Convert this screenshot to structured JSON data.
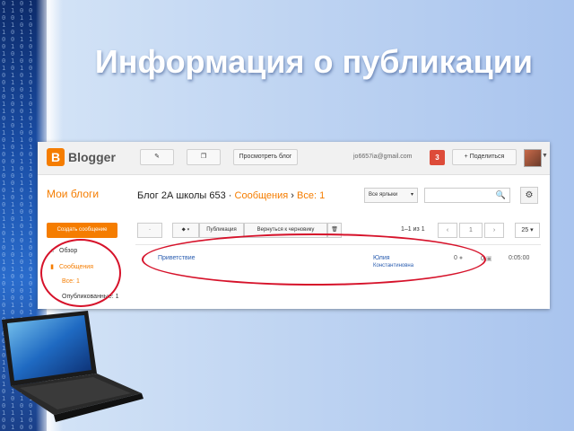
{
  "slide": {
    "title": "Информация о публикации"
  },
  "topbar": {
    "logo_letter": "B",
    "logo_text": "Blogger",
    "edit_icon": "pencil-icon",
    "copy_icon": "copy-icon",
    "view_blog_label": "Просмотреть блог",
    "email": "jo6657ia@gmail.com",
    "notifications_count": "3",
    "share_label": "+ Поделиться",
    "avatar_icon": "user-avatar"
  },
  "header": {
    "my_blogs": "Мои блоги",
    "blog_name": "Блог 2А школы 653",
    "separator": "·",
    "section": "Сообщения",
    "arrow": "›",
    "filter": "Все: 1",
    "period_select": "Все ярлыки",
    "search_placeholder": ""
  },
  "actions": {
    "create_post": "Создать сообщение",
    "tag_icon": "tag-icon",
    "publish_label": "Публикация",
    "revert_label": "Вернуться к черновику",
    "delete_icon": "trash-icon",
    "pagination": "1–1 из 1",
    "page_prev": "‹",
    "page_num": "1",
    "page_next": "›",
    "per_page": "25"
  },
  "sidebar": {
    "items": [
      {
        "label": "Обзор",
        "icon": "home-icon",
        "active": false
      },
      {
        "label": "Сообщения",
        "icon": "posts-icon",
        "active": true
      },
      {
        "label": "Все: 1",
        "icon": "",
        "active": true
      },
      {
        "label": "Опубликованные: 1",
        "icon": "",
        "active": false
      }
    ]
  },
  "posts": [
    {
      "title": "Приветствие",
      "author": "Юлия",
      "author_sub": "Константиновна",
      "comments": "0",
      "views": "0",
      "time": "0:05:00"
    }
  ],
  "colors": {
    "accent": "#f57d00",
    "link": "#2a5db0",
    "annotation": "#d6122a",
    "title": "#ffffff"
  }
}
